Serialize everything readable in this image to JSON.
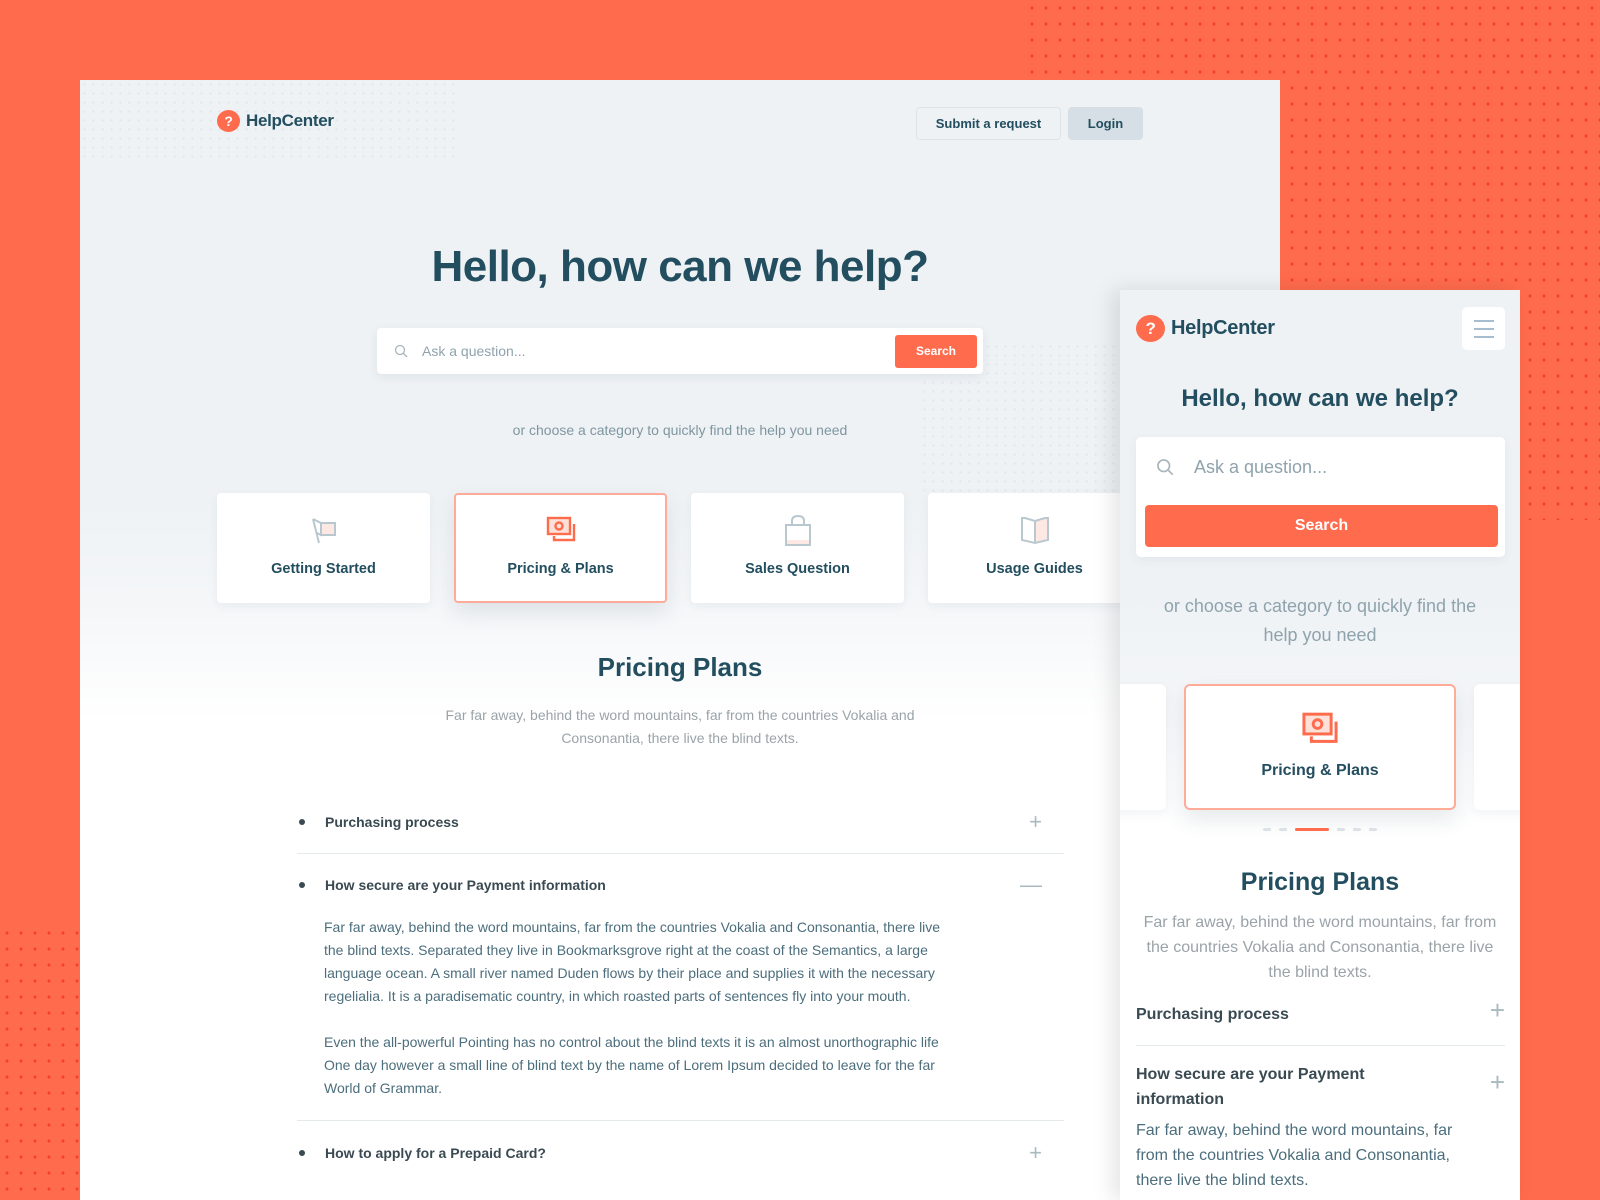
{
  "colors": {
    "brand": "#ff6b4d",
    "heading": "#234e5f",
    "muted": "#8fa3ad",
    "active_border": "#ffab98"
  },
  "desktop": {
    "logo": {
      "icon": "question-mark-icon",
      "glyph": "?",
      "text": "HelpCenter"
    },
    "nav": {
      "submit_request": "Submit a request",
      "login": "Login"
    },
    "hero": {
      "title": "Hello, how can we help?",
      "search_placeholder": "Ask a question...",
      "search_value": "",
      "search_button": "Search",
      "hint": "or choose a category to quickly find the help you need"
    },
    "categories": [
      {
        "label": "Getting Started",
        "icon": "flag-icon",
        "active": false
      },
      {
        "label": "Pricing & Plans",
        "icon": "money-bills-icon",
        "active": true
      },
      {
        "label": "Sales Question",
        "icon": "shopping-bag-icon",
        "active": false
      },
      {
        "label": "Usage Guides",
        "icon": "open-book-icon",
        "active": false
      }
    ],
    "section": {
      "title": "Pricing Plans",
      "subtitle": "Far far away, behind the word mountains, far from the countries Vokalia and Consonantia, there live the blind texts."
    },
    "faq": [
      {
        "question": "Purchasing process",
        "toggle": "+",
        "open": false
      },
      {
        "question": "How secure are your Payment information",
        "toggle": "—",
        "open": true,
        "answer": [
          "Far far away, behind the word mountains, far from the countries Vokalia and Consonantia, there live the blind texts. Separated they live in Bookmarksgrove right at the coast of the Semantics, a large language ocean. A small river named Duden flows by their place and supplies it with the necessary regelialia. It is a paradisematic country, in which roasted parts of sentences fly into your mouth.",
          "Even the all-powerful Pointing has no control about the blind texts it is an almost unorthographic life One day however a small line of blind text by the name of Lorem Ipsum decided to leave for the far World of Grammar."
        ]
      },
      {
        "question": "How to apply for a Prepaid Card?",
        "toggle": "+",
        "open": false
      }
    ]
  },
  "mobile": {
    "logo": {
      "glyph": "?",
      "text": "HelpCenter"
    },
    "menu_icon": "hamburger-menu-icon",
    "title": "Hello, how can we help?",
    "search_placeholder": "Ask a question...",
    "search_value": "",
    "search_button": "Search",
    "hint": "or choose a category to quickly find the help you need",
    "carousel": {
      "active_label": "Pricing & Plans",
      "total_slides": 6,
      "active_index": 2
    },
    "section": {
      "title": "Pricing Plans",
      "subtitle": "Far far away, behind the word mountains, far from the countries Vokalia and Consonantia, there live the blind texts."
    },
    "faq": [
      {
        "question": "Purchasing process",
        "toggle": "+"
      },
      {
        "question": "How secure are your Payment information",
        "toggle": "+",
        "answer": "Far far away, behind the word mountains, far from the countries Vokalia and Consonantia, there live the blind texts."
      }
    ]
  }
}
